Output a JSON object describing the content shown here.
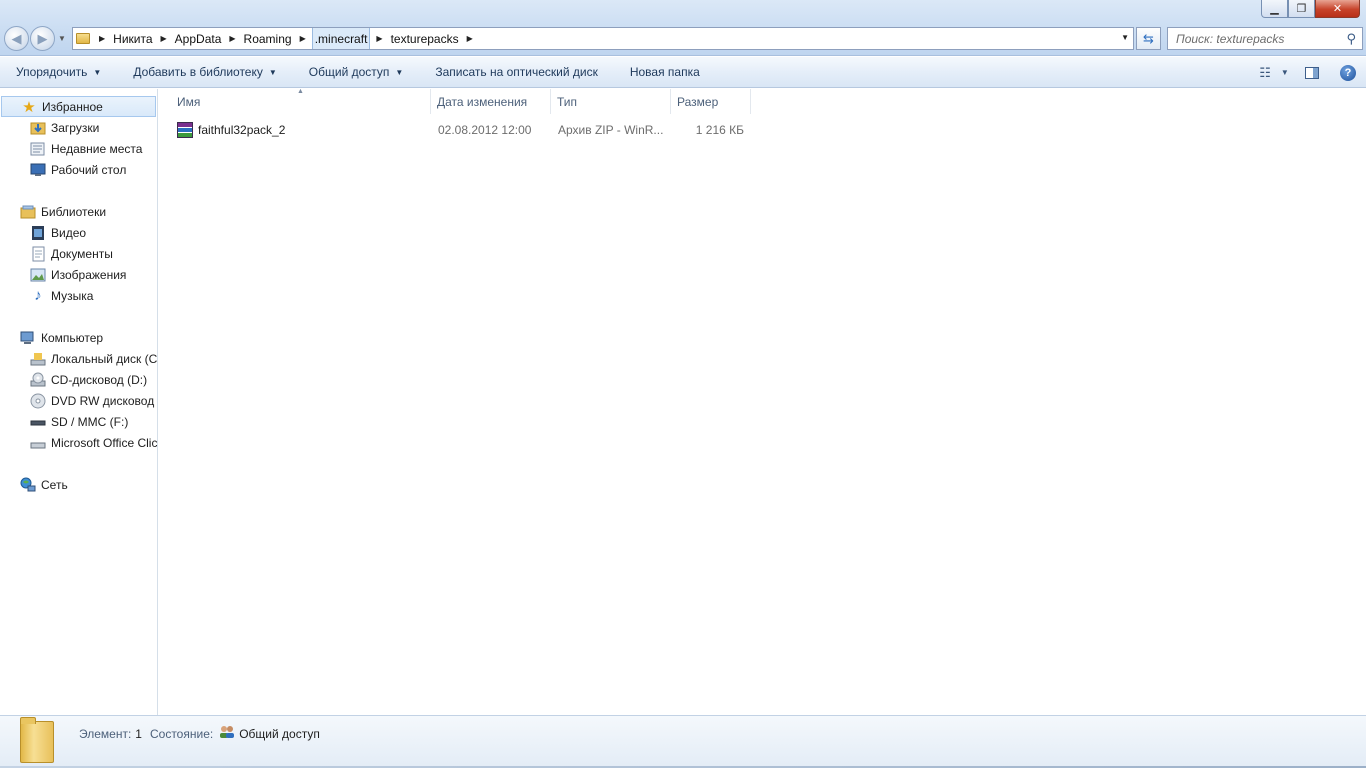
{
  "window": {
    "minimize_symbol": "▁",
    "maximize_symbol": "❐",
    "close_symbol": "✕"
  },
  "address_bar": {
    "breadcrumbs": [
      "Никита",
      "AppData",
      "Roaming",
      ".minecraft",
      "texturepacks"
    ],
    "active_crumb": ".minecraft"
  },
  "search": {
    "placeholder": "Поиск: texturepacks"
  },
  "toolbar": {
    "organize": "Упорядочить",
    "add_to_library": "Добавить в библиотеку",
    "share": "Общий доступ",
    "burn": "Записать на оптический диск",
    "new_folder": "Новая папка"
  },
  "sidebar": {
    "favorites": {
      "label": "Избранное",
      "items": [
        "Загрузки",
        "Недавние места",
        "Рабочий стол"
      ]
    },
    "libraries": {
      "label": "Библиотеки",
      "items": [
        "Видео",
        "Документы",
        "Изображения",
        "Музыка"
      ]
    },
    "computer": {
      "label": "Компьютер",
      "items": [
        "Локальный диск (C",
        "CD-дисковод (D:)",
        "DVD RW дисковод (",
        "SD / MMC (F:)",
        "Microsoft Office Clic"
      ]
    },
    "network": {
      "label": "Сеть"
    }
  },
  "columns": {
    "name": "Имя",
    "date": "Дата изменения",
    "type": "Тип",
    "size": "Размер"
  },
  "files": [
    {
      "name": "faithful32pack_2",
      "date": "02.08.2012 12:00",
      "type": "Архив ZIP - WinR...",
      "size": "1 216 КБ",
      "icon": "winrar-archive-icon"
    }
  ],
  "details": {
    "items_label": "Элемент:",
    "items_count": "1",
    "state_label": "Состояние:",
    "state_value": "Общий доступ"
  },
  "colors": {
    "accent": "#1e395b",
    "selection": "#dbeaf9",
    "close_button": "#c7432a"
  }
}
